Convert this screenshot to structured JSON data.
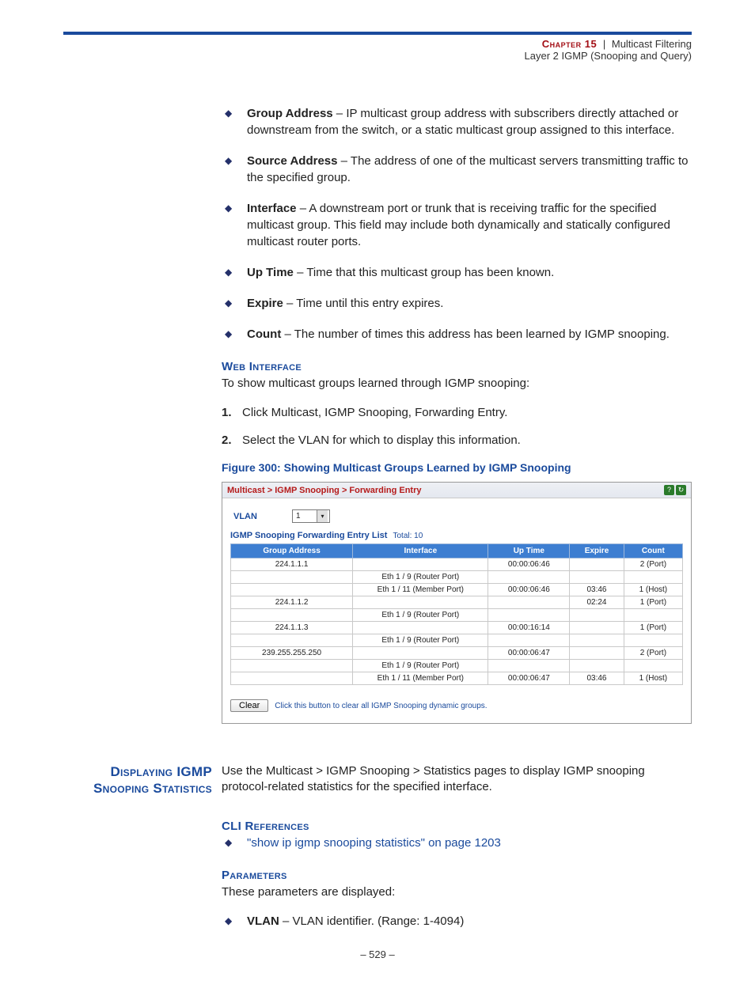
{
  "header": {
    "chapter": "Chapter 15",
    "pipe": "|",
    "section": "Multicast Filtering",
    "subsection": "Layer 2 IGMP (Snooping and Query)"
  },
  "bullets": [
    {
      "term": "Group Address",
      "desc": " – IP multicast group address with subscribers directly attached or downstream from the switch, or a static multicast group assigned to this interface."
    },
    {
      "term": "Source Address",
      "desc": " – The address of one of the multicast servers transmitting traffic to the specified group."
    },
    {
      "term": "Interface",
      "desc": " – A downstream port or trunk that is receiving traffic for the specified multicast group. This field may include both dynamically and statically configured multicast router ports."
    },
    {
      "term": "Up Time",
      "desc": " – Time that this multicast group has been known."
    },
    {
      "term": "Expire",
      "desc": " – Time until this entry expires."
    },
    {
      "term": "Count",
      "desc": " – The number of times this address has been learned by IGMP snooping."
    }
  ],
  "web_interface": {
    "heading": "Web Interface",
    "intro": "To show multicast groups learned through IGMP snooping:",
    "steps": [
      "Click Multicast, IGMP Snooping, Forwarding Entry.",
      "Select the VLAN for which to display this information."
    ]
  },
  "figure": {
    "caption": "Figure 300:  Showing Multicast Groups Learned by IGMP Snooping"
  },
  "screenshot": {
    "breadcrumb": "Multicast > IGMP Snooping > Forwarding Entry",
    "vlan_label": "VLAN",
    "vlan_value": "1",
    "list_name": "IGMP Snooping Forwarding Entry List",
    "list_total": "Total: 10",
    "columns": [
      "Group Address",
      "Interface",
      "Up Time",
      "Expire",
      "Count"
    ],
    "rows": [
      {
        "group": "224.1.1.1",
        "intf": "",
        "up": "00:00:06:46",
        "exp": "",
        "cnt": "2 (Port)"
      },
      {
        "group": "",
        "intf": "Eth 1 / 9 (Router Port)",
        "up": "",
        "exp": "",
        "cnt": ""
      },
      {
        "group": "",
        "intf": "Eth 1 / 11 (Member Port)",
        "up": "00:00:06:46",
        "exp": "03:46",
        "cnt": "1 (Host)"
      },
      {
        "group": "224.1.1.2",
        "intf": "",
        "up": "",
        "exp": "02:24",
        "cnt": "1 (Port)"
      },
      {
        "group": "",
        "intf": "Eth 1 / 9 (Router Port)",
        "up": "",
        "exp": "",
        "cnt": ""
      },
      {
        "group": "224.1.1.3",
        "intf": "",
        "up": "00:00:16:14",
        "exp": "",
        "cnt": "1 (Port)"
      },
      {
        "group": "",
        "intf": "Eth 1 / 9 (Router Port)",
        "up": "",
        "exp": "",
        "cnt": ""
      },
      {
        "group": "239.255.255.250",
        "intf": "",
        "up": "00:00:06:47",
        "exp": "",
        "cnt": "2 (Port)"
      },
      {
        "group": "",
        "intf": "Eth 1 / 9 (Router Port)",
        "up": "",
        "exp": "",
        "cnt": ""
      },
      {
        "group": "",
        "intf": "Eth 1 / 11 (Member Port)",
        "up": "00:00:06:47",
        "exp": "03:46",
        "cnt": "1 (Host)"
      }
    ],
    "clear_btn": "Clear",
    "clear_hint": "Click this button to clear all IGMP Snooping dynamic groups."
  },
  "stats": {
    "side_heading_l1": "Displaying IGMP",
    "side_heading_l2": "Snooping Statistics",
    "body": "Use the Multicast > IGMP Snooping > Statistics pages to display IGMP snooping protocol-related statistics for the specified interface."
  },
  "cli": {
    "heading": "CLI References",
    "link": "\"show ip igmp snooping statistics\" on page 1203"
  },
  "params": {
    "heading": "Parameters",
    "intro": "These parameters are displayed:",
    "items": [
      {
        "term": "VLAN",
        "desc": " – VLAN identifier. (Range: 1-4094)"
      }
    ]
  },
  "pagenum": "–  529  –"
}
